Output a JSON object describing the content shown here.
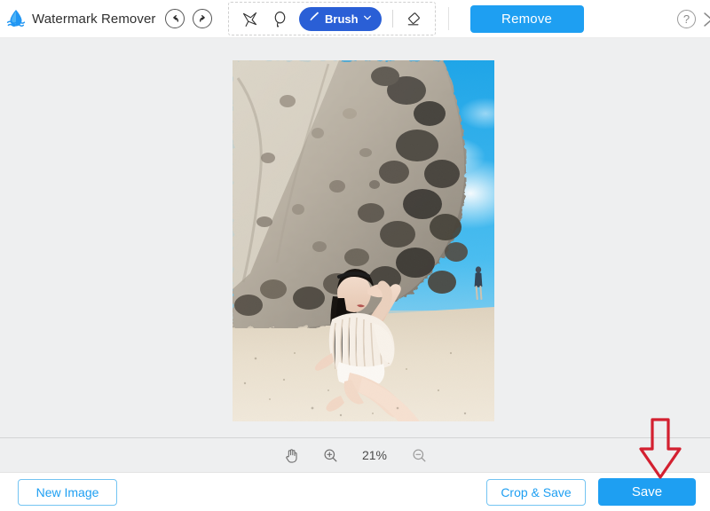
{
  "app": {
    "title": "Watermark Remover",
    "logo_icon": "water-drop-logo"
  },
  "header": {
    "undo_label": "Undo",
    "undo_icon": "undo-arrow-icon",
    "redo_label": "Redo",
    "redo_icon": "redo-arrow-icon",
    "tools": [
      {
        "name": "polygonal-lasso",
        "label": "Polygonal Lasso",
        "icon": "polygonal-lasso-icon",
        "active": false
      },
      {
        "name": "freehand-lasso",
        "label": "Lasso",
        "icon": "lasso-icon",
        "active": false
      }
    ],
    "brush": {
      "label": "Brush",
      "icon": "brush-icon",
      "chevron": "chevron-down-icon",
      "active": true,
      "color": "#2a5fd6"
    },
    "eraser": {
      "label": "Eraser",
      "icon": "eraser-icon",
      "active": false
    },
    "remove_label": "Remove",
    "remove_color": "#1e9ff2",
    "help_label": "?",
    "help_icon": "help-circle-icon",
    "close_icon": "close-icon"
  },
  "canvas": {
    "image_alt": "Woman sitting on sandy beach in front of a rocky cliff under blue sky",
    "zoom_level": "21%",
    "pan_icon": "hand-pan-icon",
    "zoom_in_icon": "zoom-in-icon",
    "zoom_out_icon": "zoom-out-icon"
  },
  "footer": {
    "new_image_label": "New Image",
    "crop_save_label": "Crop & Save",
    "save_label": "Save",
    "accent_color": "#1e9ff2"
  },
  "annotation": {
    "arrow_icon": "down-arrow-annotation",
    "color": "#d32030",
    "points_at": "Save"
  }
}
